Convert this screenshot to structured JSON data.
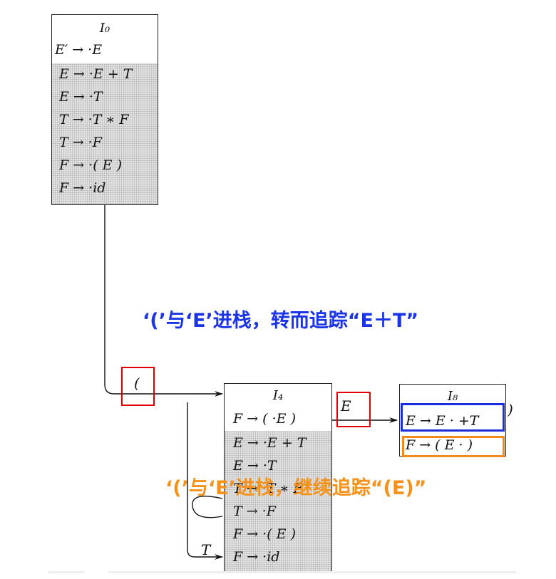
{
  "states": {
    "i0": {
      "title": "I₀",
      "items": [
        "E′ → ·E",
        "E → ·E + T",
        "E → ·T",
        "T → ·T ∗ F",
        "T → ·F",
        "F → ·( E )",
        "F → ·id"
      ]
    },
    "i4": {
      "title": "I₄",
      "items": [
        "F → ( ·E )",
        "E → ·E + T",
        "E → ·T",
        "T → ·T ∗ F",
        "T → ·F",
        "F → ·( E )",
        "F → ·id"
      ]
    },
    "i8": {
      "title": "I₈",
      "items": [
        "E → E · +T",
        "F → ( E · )"
      ],
      "trailing": ")"
    }
  },
  "transitions": {
    "paren": "(",
    "e": "E",
    "t": "T"
  },
  "annotations": {
    "blue": "‘(’与‘E’进栈，转而追踪“E＋T”",
    "orange": "‘(’与‘E’进栈，继续追踪“(E)”"
  },
  "colors": {
    "highlight_red": "#e10000",
    "highlight_blue": "#1a2ee0",
    "highlight_orange": "#f08a1a",
    "note_blue": "#1a34e6",
    "note_orange": "#f5921b"
  }
}
